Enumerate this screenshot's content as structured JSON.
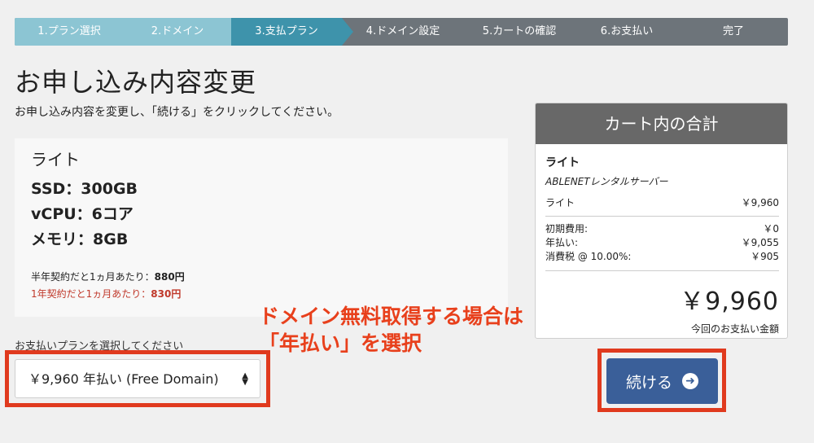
{
  "steps": [
    {
      "label": "1.プラン選択",
      "state": "done"
    },
    {
      "label": "2.ドメイン",
      "state": "done"
    },
    {
      "label": "3.支払プラン",
      "state": "current"
    },
    {
      "label": "4.ドメイン設定",
      "state": "todo"
    },
    {
      "label": "5.カートの確認",
      "state": "todo"
    },
    {
      "label": "6.お支払い",
      "state": "todo"
    },
    {
      "label": "完了",
      "state": "todo"
    }
  ],
  "page": {
    "title": "お申し込み内容変更",
    "instructions": "お申し込み内容を変更し、「続ける」をクリックしてください。"
  },
  "plan": {
    "name": "ライト",
    "specs": [
      "SSD：300GB",
      "vCPU：6コア",
      "メモリ：8GB"
    ],
    "half_year_label": "半年契約だと1ヵ月あたり：",
    "half_year_price": "880円",
    "yearly_label": "1年契約だと1ヵ月あたり：",
    "yearly_price": "830円"
  },
  "payment": {
    "label": "お支払いプランを選択してください",
    "selected": "￥9,960 年払い (Free Domain)"
  },
  "annotation": {
    "line1": "ドメイン無料取得する場合は",
    "line2": "「年払い」を選択"
  },
  "cart": {
    "header": "カート内の合計",
    "product": "ライト",
    "vendor": "ABLENETレンタルサーバー",
    "item_label": "ライト",
    "item_price": "￥9,960",
    "setup_label": "初期費用:",
    "setup_value": "￥0",
    "annual_label": "年払い:",
    "annual_value": "￥9,055",
    "tax_label": "消費税 @ 10.00%:",
    "tax_value": "￥905",
    "total": "￥9,960",
    "total_label": "今回のお支払い金額"
  },
  "continue_button": {
    "label": "続ける",
    "icon": "arrow-right-circle-icon"
  },
  "colors": {
    "step_done": "#8cc5d3",
    "step_current": "#3e93ab",
    "step_bar": "#6d747a",
    "highlight": "#e03a1e",
    "button": "#3a5f99",
    "price_red": "#c0392b"
  }
}
